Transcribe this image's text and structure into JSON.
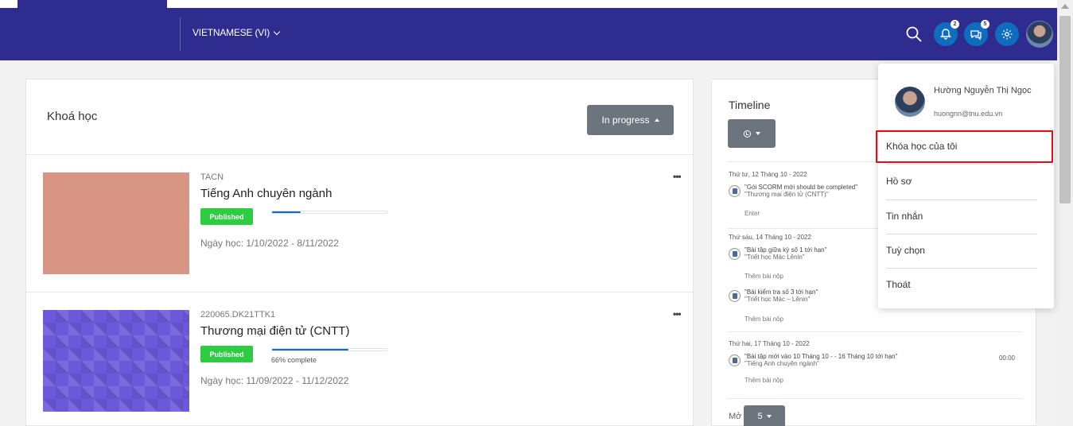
{
  "navbar": {
    "language_label": "VIETNAMESE (VI)",
    "notifications_badge": "2",
    "messages_badge": "5"
  },
  "courses_panel": {
    "title": "Khoá học",
    "filter_label": "In progress"
  },
  "courses": [
    {
      "code": "TACN",
      "name": "Tiếng Anh chuyên ngành",
      "status": "Published",
      "progress": 0.25,
      "progress_text": "",
      "dates": "Ngày học: 1/10/2022 - 8/11/2022",
      "thumb_color": "#d99583"
    },
    {
      "code": "220065.DK21TTK1",
      "name": "Thương mại điện tử (CNTT)",
      "status": "Published",
      "progress": 0.66,
      "progress_text": "66% complete",
      "dates": "Ngày học: 11/09/2022 - 11/12/2022",
      "thumb_color": "#6c59d9"
    }
  ],
  "timeline": {
    "title": "Timeline",
    "groups": [
      {
        "day": "Thứ tư, 12 Tháng 10 - 2022",
        "items": [
          {
            "line1": "\"Gói SCORM mới should be completed\"",
            "line2": "\"Thương mại điện tử (CNTT)\"",
            "action": "Enter",
            "time": ""
          }
        ]
      },
      {
        "day": "Thứ sáu, 14 Tháng 10 - 2022",
        "items": [
          {
            "line1": "\"Bài tập giữa kỳ số 1 tới hạn\"",
            "line2": "\"Triết học Mác Lênin\"",
            "action": "Thêm bài nộp",
            "time": ""
          },
          {
            "line1": "\"Bài kiểm tra số 3 tới hạn\"",
            "line2": "\"Triết học Mác – Lênin\"",
            "action": "Thêm bài nộp",
            "time": ""
          }
        ]
      },
      {
        "day": "Thứ hai, 17 Tháng 10 - 2022",
        "items": [
          {
            "line1": "\"Bài tập mới vào 10 Tháng 10 - - 16 Tháng 10 tới hạn\"",
            "line2": "\"Tiếng Anh chuyên ngành\"",
            "action": "Thêm bài nộp",
            "time": "00:00"
          }
        ]
      }
    ],
    "more_label": "Mở",
    "count_value": "5"
  },
  "user_menu": {
    "name": "Hường Nguyễn Thị Ngọc",
    "email": "huongnn@tnu.edu.vn",
    "items": [
      "Khóa học của tôi",
      "Hồ sơ",
      "Tin nhắn",
      "Tuỳ chọn",
      "Thoát"
    ]
  },
  "colors": {
    "navbar": "#2f2c8f",
    "primary": "#0f6cbf",
    "published": "#2ecc40",
    "highlight": "#e60b16"
  }
}
